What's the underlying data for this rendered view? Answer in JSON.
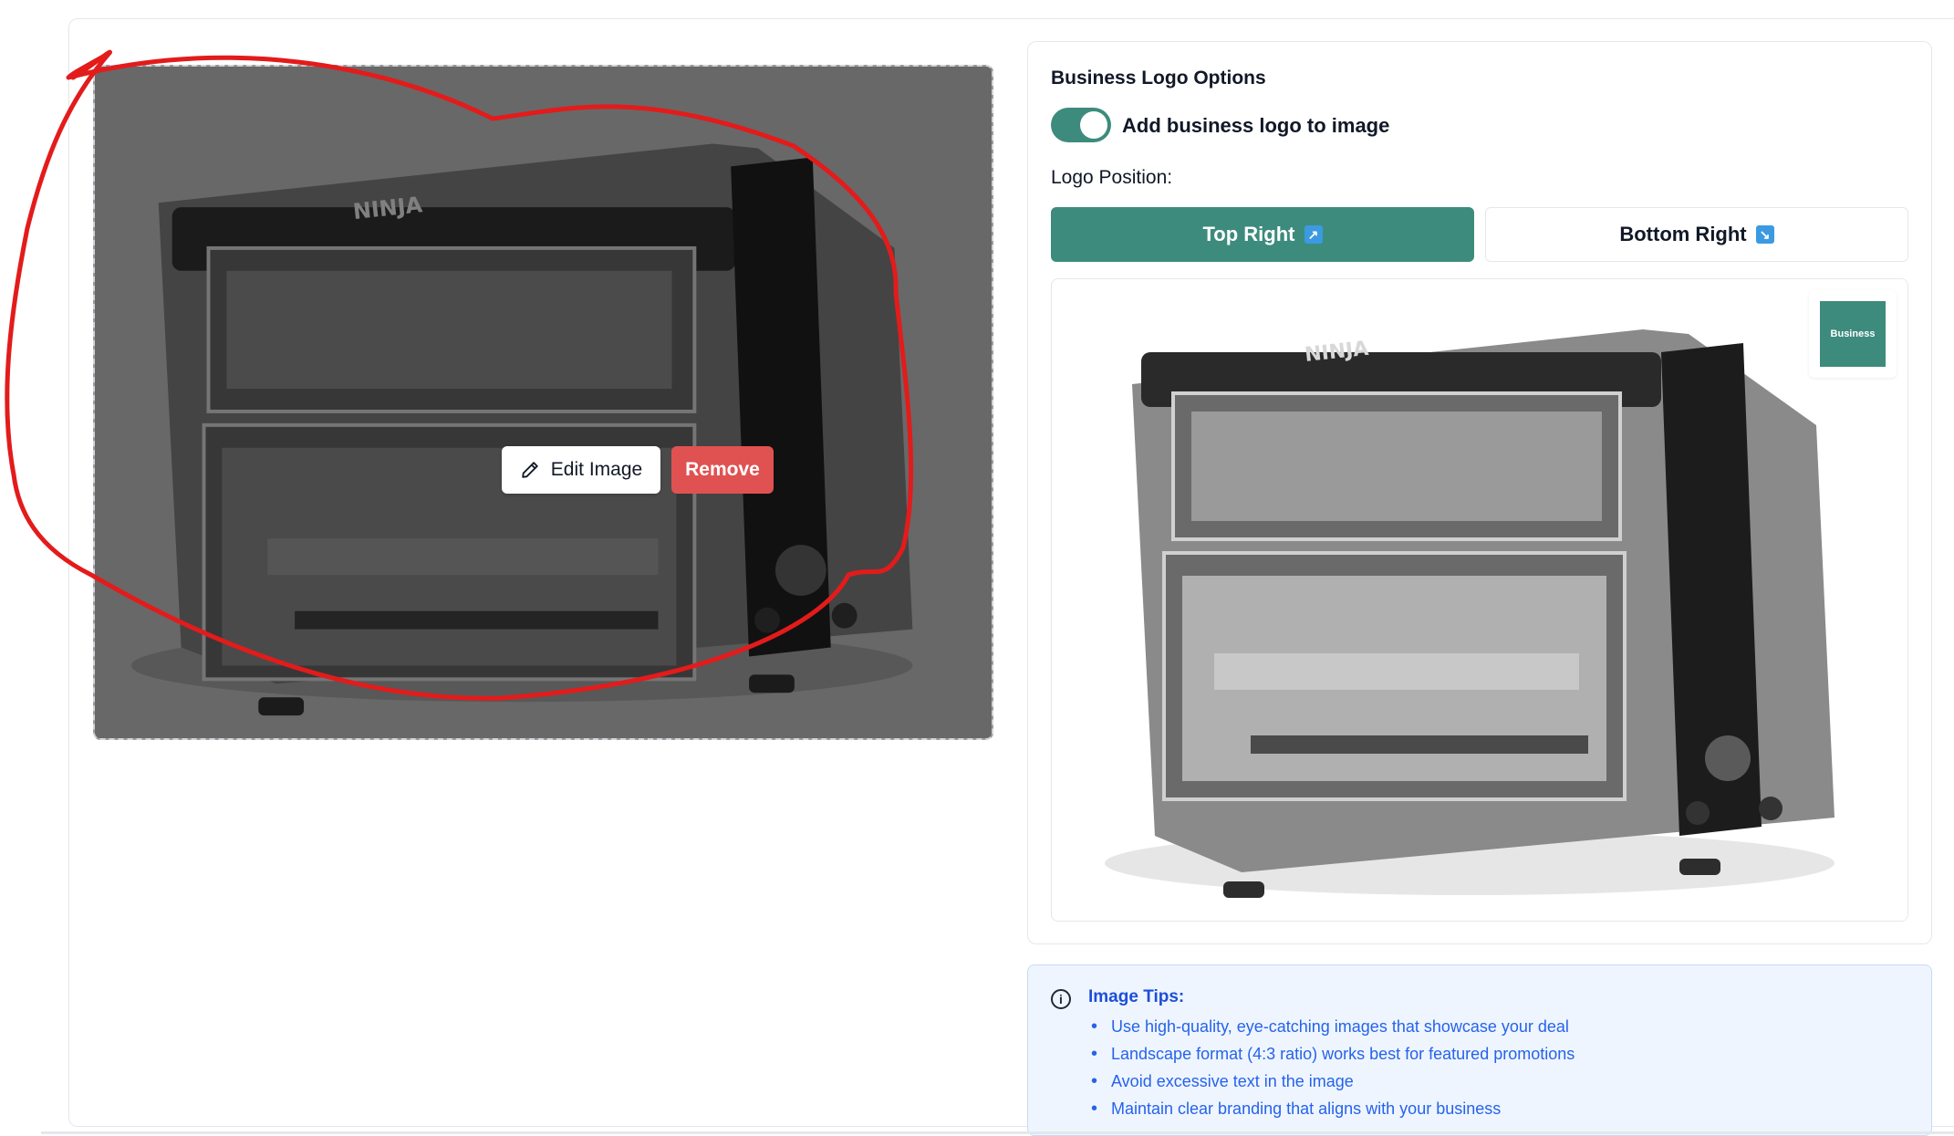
{
  "editor": {
    "edit_label": "Edit Image",
    "remove_label": "Remove"
  },
  "product": {
    "brand_text": "NINJA"
  },
  "logo_options": {
    "title": "Business Logo Options",
    "toggle_label": "Add business logo to image",
    "toggle_on": true,
    "position_label": "Logo Position:",
    "positions": [
      {
        "label": "Top Right",
        "icon": "arrow-up-right-icon",
        "active": true
      },
      {
        "label": "Bottom Right",
        "icon": "arrow-down-right-icon",
        "active": false
      }
    ],
    "logo_text": "Business"
  },
  "tips": {
    "title": "Image Tips:",
    "items": [
      "Use high-quality, eye-catching images that showcase your deal",
      "Landscape format (4:3 ratio) works best for featured promotions",
      "Avoid excessive text in the image",
      "Maintain clear branding that aligns with your business"
    ]
  },
  "colors": {
    "accent": "#3d8b7d",
    "remove": "#e05252",
    "annotation": "#e31b1b",
    "tips_text": "#2563eb"
  }
}
